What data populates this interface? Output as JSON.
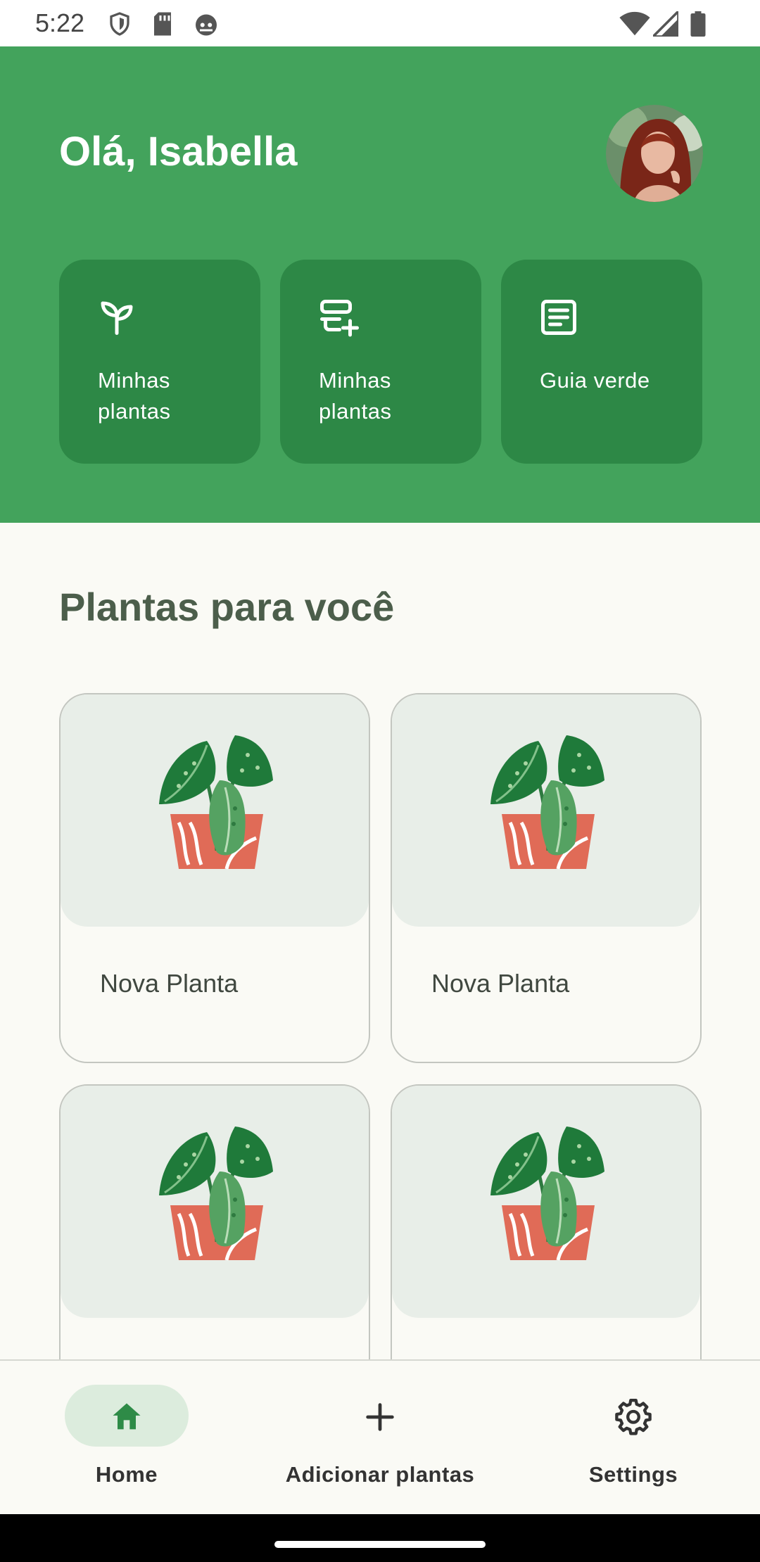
{
  "status_bar": {
    "time": "5:22",
    "left_icons": [
      "shield-icon",
      "sd-card-icon",
      "android-icon"
    ],
    "right_icons": [
      "wifi-icon",
      "signal-icon",
      "battery-icon"
    ]
  },
  "header": {
    "greeting": "Olá, Isabella",
    "background_color": "#43A35C",
    "card_color": "#2D8846"
  },
  "quick_actions": [
    {
      "label": "Minhas plantas",
      "icon": "sprout-icon"
    },
    {
      "label": "Minhas plantas",
      "icon": "playlist-add-icon"
    },
    {
      "label": "Guia verde",
      "icon": "article-icon"
    }
  ],
  "section": {
    "title": "Plantas para você"
  },
  "plants": [
    {
      "name": "Nova Planta"
    },
    {
      "name": "Nova Planta"
    },
    {
      "name": ""
    },
    {
      "name": ""
    }
  ],
  "bottom_nav": {
    "items": [
      {
        "label": "Home",
        "icon": "home-icon",
        "selected": true
      },
      {
        "label": "Adicionar plantas",
        "icon": "plus-icon",
        "selected": false
      },
      {
        "label": "Settings",
        "icon": "gear-icon",
        "selected": false
      }
    ]
  }
}
